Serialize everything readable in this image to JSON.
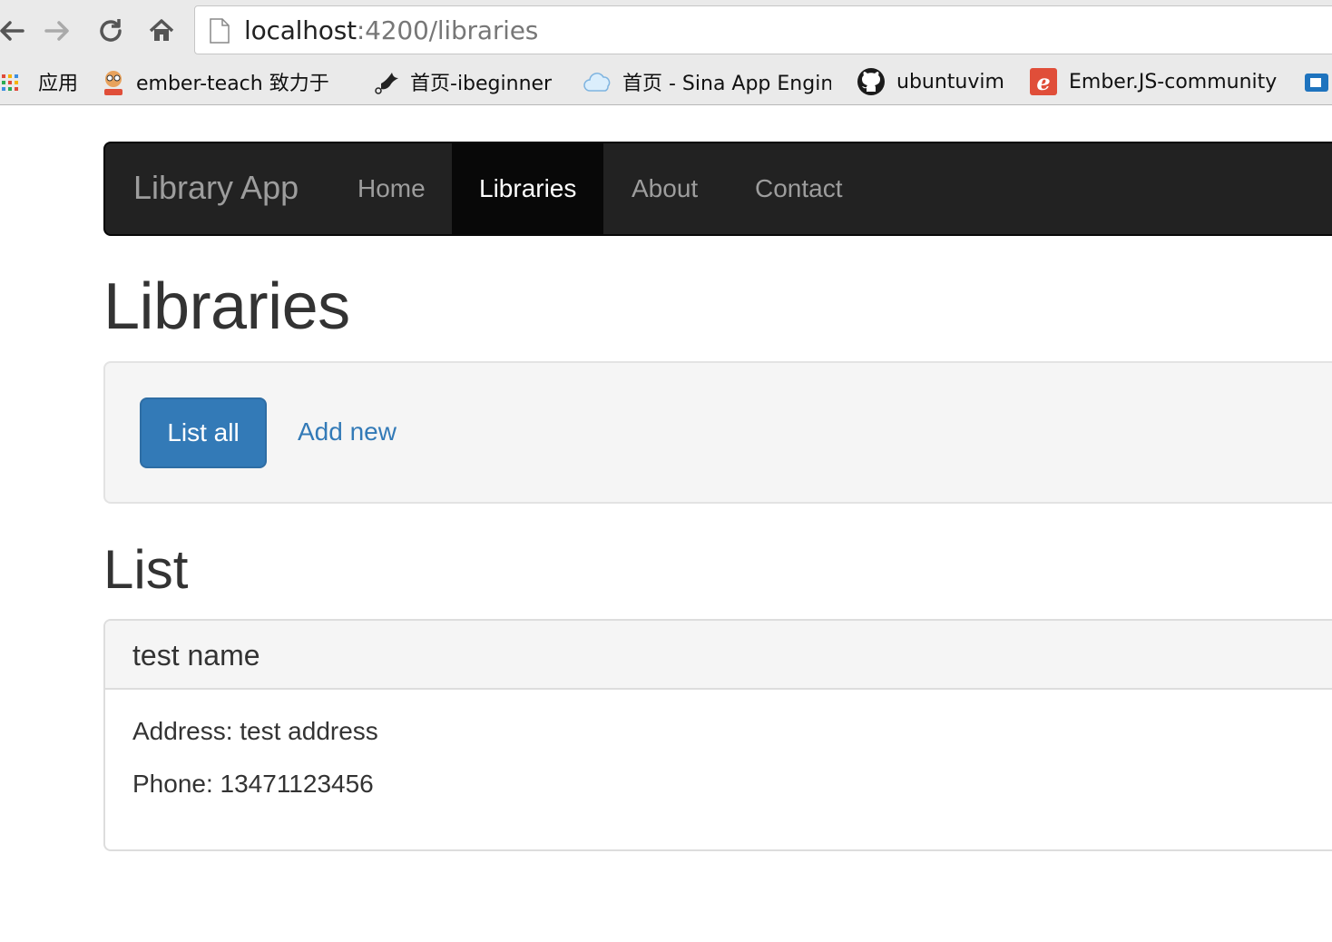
{
  "browser": {
    "url_host": "localhost",
    "url_path": ":4200/libraries",
    "bookmarks": [
      {
        "icon": "apps-grid-icon",
        "label": "应用"
      },
      {
        "icon": "ember-mascot-icon",
        "label": "ember-teach  致力于"
      },
      {
        "icon": "bird-icon",
        "label": "首页-ibeginner"
      },
      {
        "icon": "cloud-icon",
        "label": "首页 - Sina App Engin"
      },
      {
        "icon": "github-icon",
        "label": "ubuntuvim"
      },
      {
        "icon": "ember-e-icon",
        "label": "Ember.JS-community"
      }
    ]
  },
  "navbar": {
    "brand": "Library App",
    "links": [
      "Home",
      "Libraries",
      "About",
      "Contact"
    ],
    "active_index": 1
  },
  "page": {
    "title": "Libraries",
    "actions": {
      "list_all": "List all",
      "add_new": "Add new"
    },
    "section_title": "List",
    "library": {
      "name": "test name",
      "address": "Address: test address",
      "phone": "Phone: 13471123456"
    }
  },
  "colors": {
    "primary": "#337ab7",
    "navbar_bg": "#222222",
    "navbar_active_bg": "#080808"
  }
}
